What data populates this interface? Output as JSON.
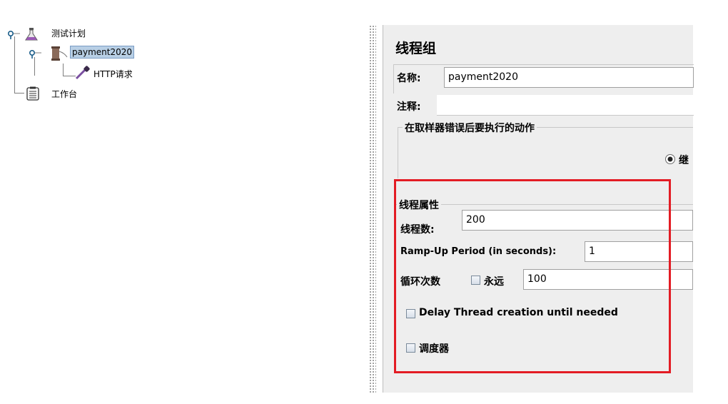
{
  "tree": {
    "plan_label": "测试计划",
    "thread_group_label": "payment2020",
    "sampler_label": "HTTP请求",
    "workbench_label": "工作台"
  },
  "panel": {
    "title": "线程组",
    "name_label": "名称:",
    "name_value": "payment2020",
    "comment_label": "注释:",
    "sampler_error_legend": "在取样器错误后要执行的动作",
    "radio_partial_label": "继",
    "thread_props_legend": "线程属性",
    "threads_label": "线程数:",
    "threads_value": "200",
    "rampup_label": "Ramp-Up Period (in seconds):",
    "rampup_value": "1",
    "loop_label": "循环次数",
    "forever_label": "永远",
    "loop_value": "100",
    "delay_label": "Delay Thread creation until needed",
    "scheduler_label": "调度器"
  },
  "colors": {
    "highlight_box": "#e31c24",
    "selection": "#b8cfe5"
  }
}
